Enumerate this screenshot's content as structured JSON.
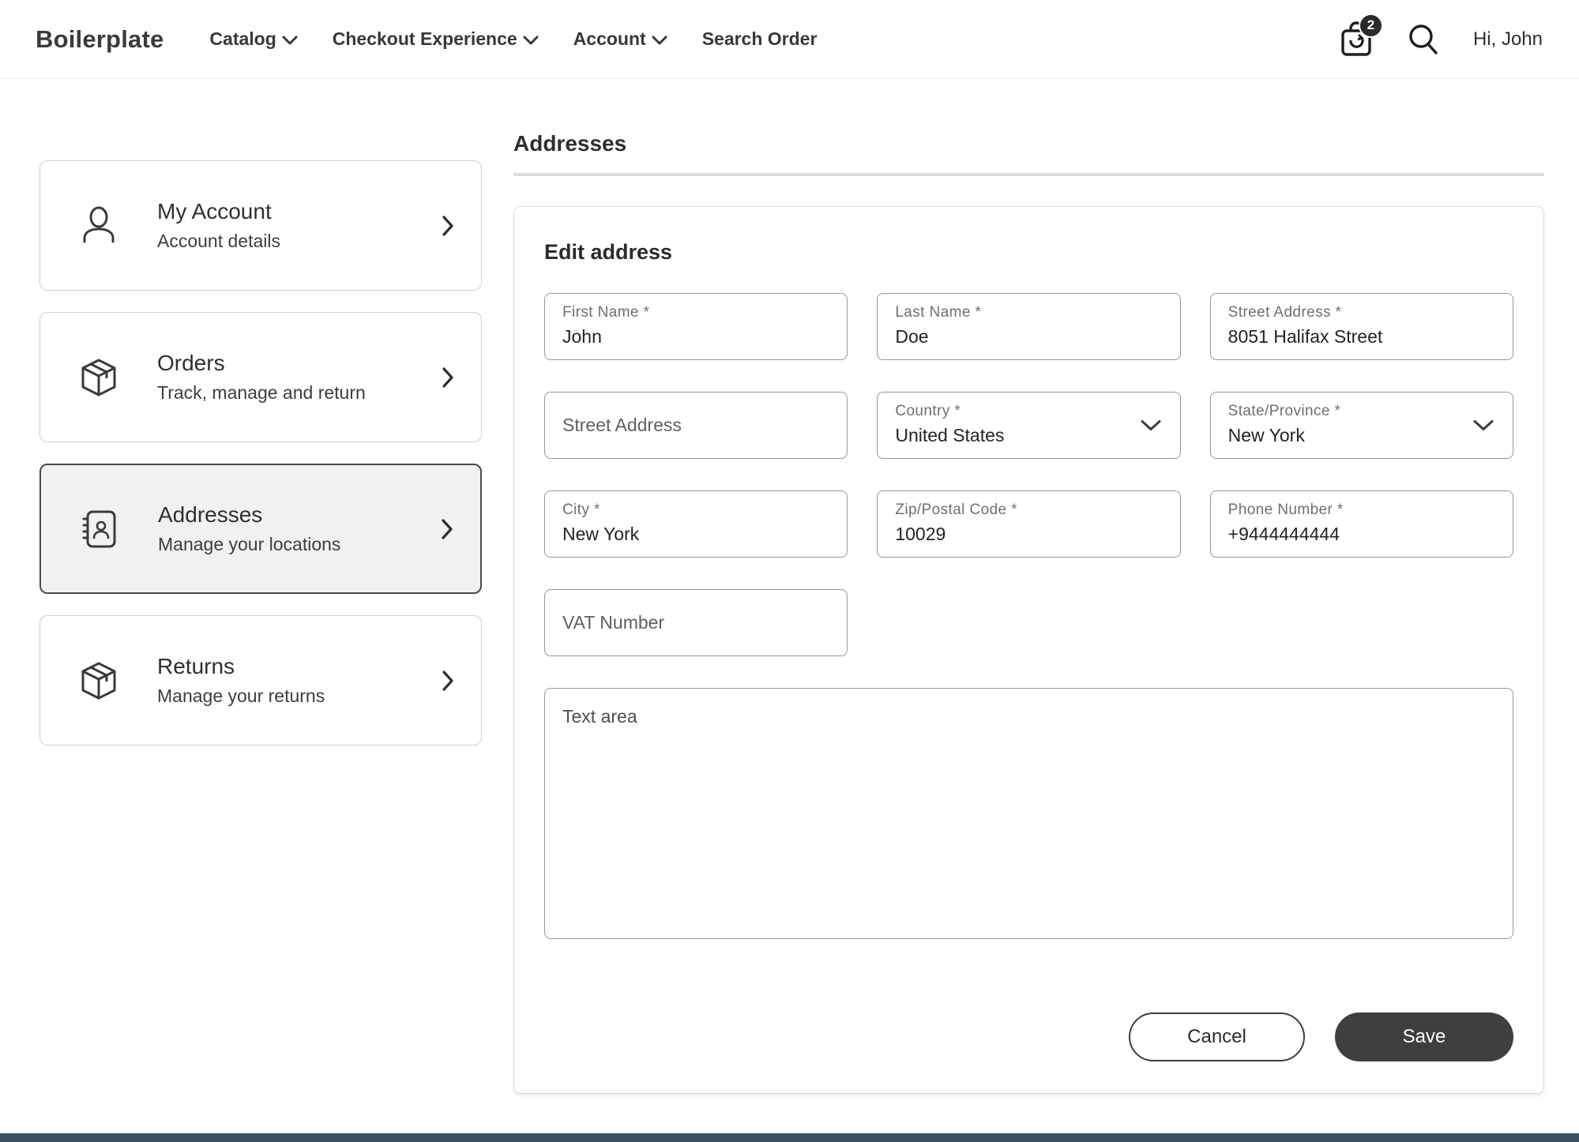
{
  "header": {
    "logo": "Boilerplate",
    "nav": [
      {
        "label": "Catalog"
      },
      {
        "label": "Checkout Experience"
      },
      {
        "label": "Account"
      },
      {
        "label": "Search Order"
      }
    ],
    "cart_badge": "2",
    "greeting": "Hi, John"
  },
  "sidebar": {
    "items": [
      {
        "title": "My Account",
        "subtitle": "Account details",
        "icon": "user-icon",
        "selected": false
      },
      {
        "title": "Orders",
        "subtitle": "Track, manage and return",
        "icon": "package-icon",
        "selected": false
      },
      {
        "title": "Addresses",
        "subtitle": "Manage your locations",
        "icon": "address-book-icon",
        "selected": true
      },
      {
        "title": "Returns",
        "subtitle": "Manage your returns",
        "icon": "package-icon",
        "selected": false
      }
    ]
  },
  "main": {
    "page_title": "Addresses",
    "card_title": "Edit address",
    "fields": {
      "first_name": {
        "label": "First Name *",
        "value": "John"
      },
      "last_name": {
        "label": "Last Name *",
        "value": "Doe"
      },
      "street_address_filled": {
        "label": "Street Address *",
        "value": "8051 Halifax Street"
      },
      "street_address_empty": {
        "placeholder": "Street Address",
        "value": ""
      },
      "country": {
        "label": "Country *",
        "value": "United States"
      },
      "state": {
        "label": "State/Province *",
        "value": "New York"
      },
      "city": {
        "label": "City *",
        "value": "New York"
      },
      "zip": {
        "label": "Zip/Postal Code *",
        "value": "10029"
      },
      "phone": {
        "label": "Phone Number *",
        "value": "+9444444444"
      },
      "vat": {
        "placeholder": "VAT Number",
        "value": ""
      },
      "notes": {
        "placeholder": "Text area",
        "value": ""
      }
    },
    "buttons": {
      "cancel": "Cancel",
      "save": "Save"
    }
  },
  "colors": {
    "selected_card_bg": "#f1f1f1",
    "selected_card_border": "#4a4a4a",
    "button_dark": "#3f3f3f",
    "footer_bar": "#3b5266",
    "badge_bg": "#2b2b2b"
  }
}
